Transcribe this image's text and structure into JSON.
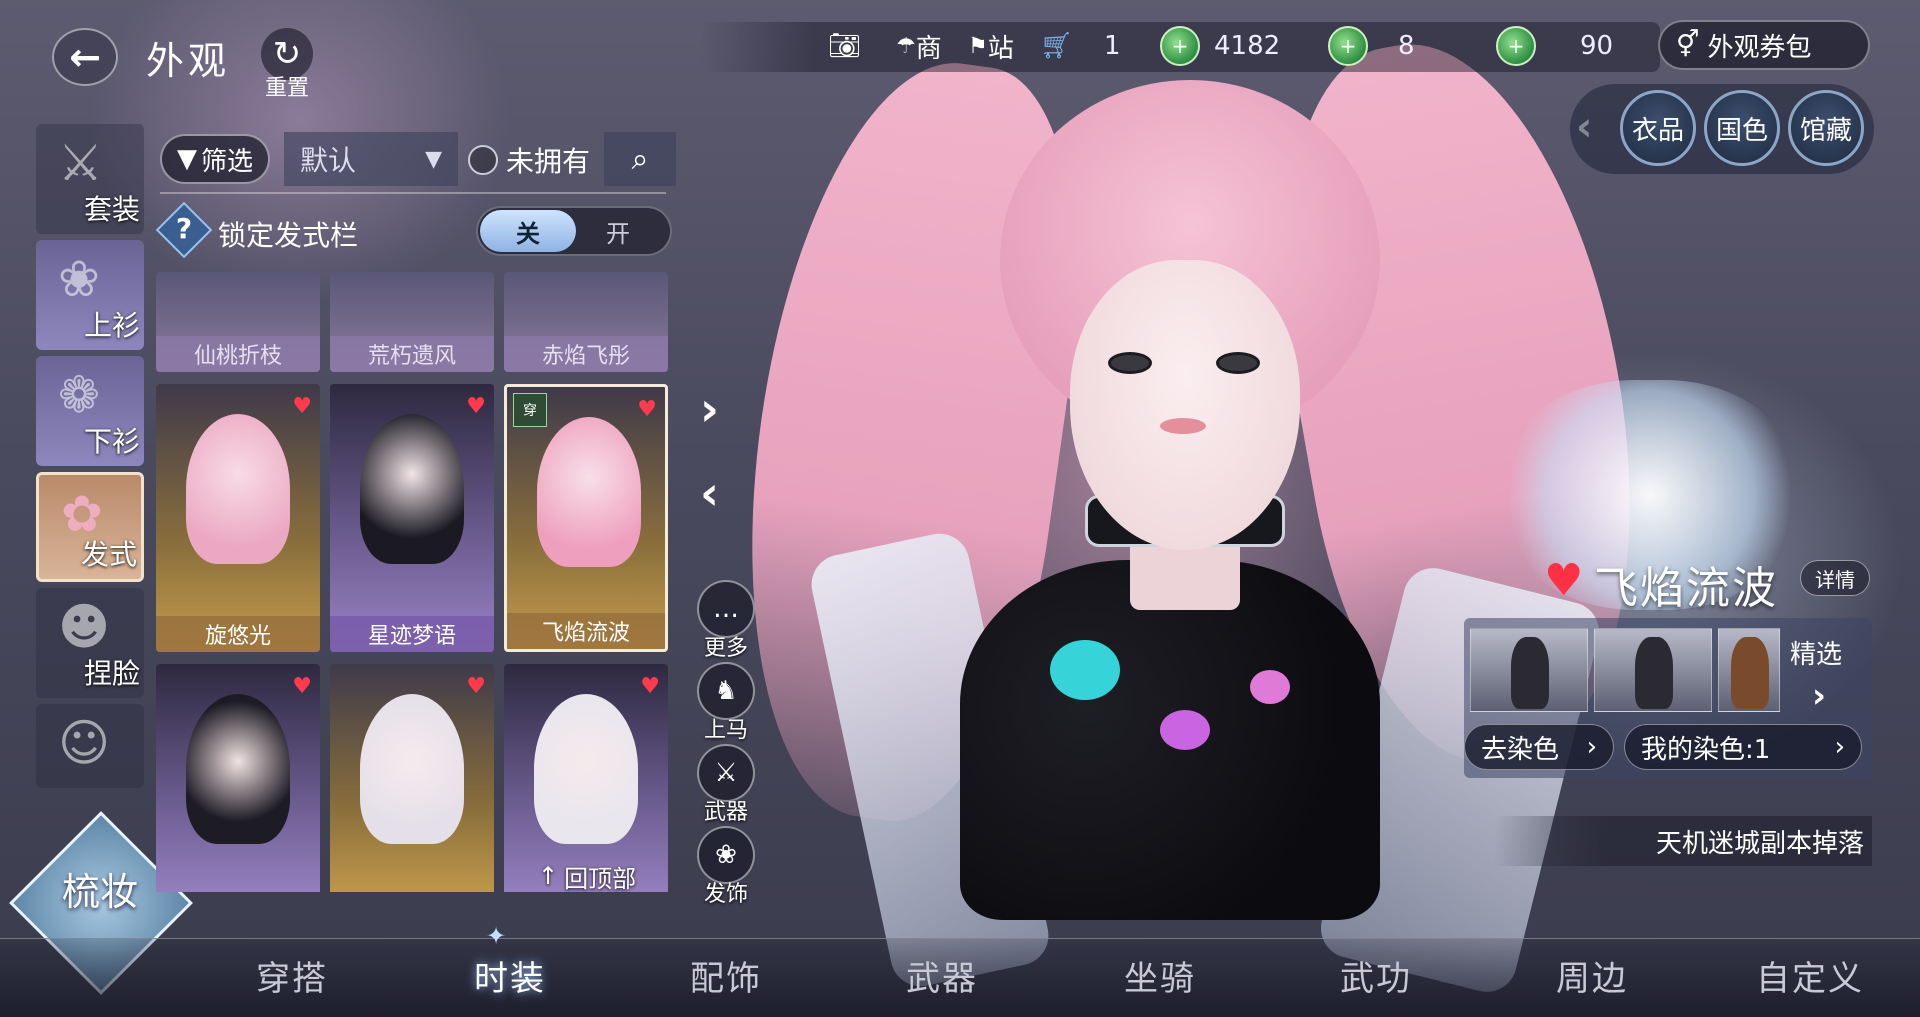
{
  "header": {
    "title": "外观",
    "reset_label": "重置"
  },
  "top_bar": {
    "shop_label": "商",
    "station_label": "站",
    "cart_count": "1",
    "currencies": [
      {
        "value": "4182"
      },
      {
        "value": "8"
      },
      {
        "value": "90"
      }
    ],
    "coupon_label": "外观券包"
  },
  "right_tabs": [
    "衣品",
    "国色",
    "馆藏"
  ],
  "categories": [
    "套装",
    "上衫",
    "下衫",
    "发式",
    "捏脸"
  ],
  "makeup_label": "梳妆",
  "filter": {
    "filter_label": "筛选",
    "sort_value": "默认",
    "not_owned_label": "未拥有",
    "lock_label": "锁定发式栏",
    "toggle_off": "关",
    "toggle_on": "开"
  },
  "items": [
    {
      "name": "仙桃折枝"
    },
    {
      "name": "荒朽遗风"
    },
    {
      "name": "赤焰飞彤"
    },
    {
      "name": "旋悠光"
    },
    {
      "name": "星迹梦语"
    },
    {
      "name": "飞焰流波",
      "badge": "穿"
    },
    {
      "name": ""
    },
    {
      "name": ""
    },
    {
      "name": ""
    }
  ],
  "back_to_top": "回顶部",
  "side_actions": [
    "更多",
    "上马",
    "武器",
    "发饰"
  ],
  "selected_item": {
    "name": "飞焰流波",
    "detail_label": "详情",
    "featured_label": "精选",
    "remove_dye_label": "去染色",
    "my_dye_label": "我的染色:1",
    "source": "天机迷城副本掉落"
  },
  "bottom_nav": [
    "穿搭",
    "时装",
    "配饰",
    "武器",
    "坐骑",
    "武功",
    "周边",
    "自定义"
  ],
  "colors": {
    "heart": "#ff3a4c",
    "hair_pink": "#f1b4cb",
    "currency_green": "#2f8d42"
  }
}
